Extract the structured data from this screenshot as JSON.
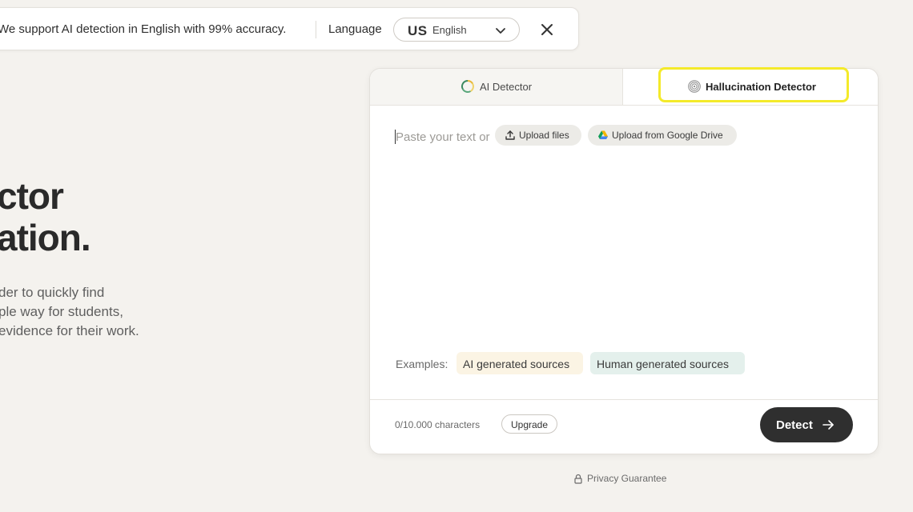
{
  "banner": {
    "message": "We support AI detection in English with 99% accuracy.",
    "language_label": "Language",
    "language_select": {
      "flag_code": "US",
      "selected": "English",
      "chevron_icon": "chevron-down-icon"
    },
    "close_icon": "close-icon"
  },
  "hero": {
    "title_line1": "ctor",
    "title_line2": "ation.",
    "description_lines": [
      "der to quickly find",
      "ple way for students,",
      "evidence for their work."
    ]
  },
  "detector": {
    "tabs": [
      {
        "label": "AI Detector",
        "icon": "progress-ring-icon",
        "active": false
      },
      {
        "label": "Hallucination Detector",
        "icon": "fingerprint-icon",
        "active": true
      }
    ],
    "highlight_color": "#f4ea2a",
    "input": {
      "placeholder": "Paste your text or",
      "upload_files_label": "Upload files",
      "upload_drive_label": "Upload from Google Drive"
    },
    "examples": {
      "label": "Examples:",
      "items": [
        "AI generated sources",
        "Human generated sources"
      ]
    },
    "footer": {
      "char_count": "0/10.000 characters",
      "upgrade_label": "Upgrade",
      "detect_label": "Detect"
    }
  },
  "privacy": {
    "label": "Privacy Guarantee",
    "icon": "lock-icon"
  },
  "colors": {
    "background": "#f4f2ee",
    "detect_button": "#2f2f2f",
    "ai_example_chip": "#fbf4e4",
    "human_example_chip": "#e4f0ec"
  }
}
